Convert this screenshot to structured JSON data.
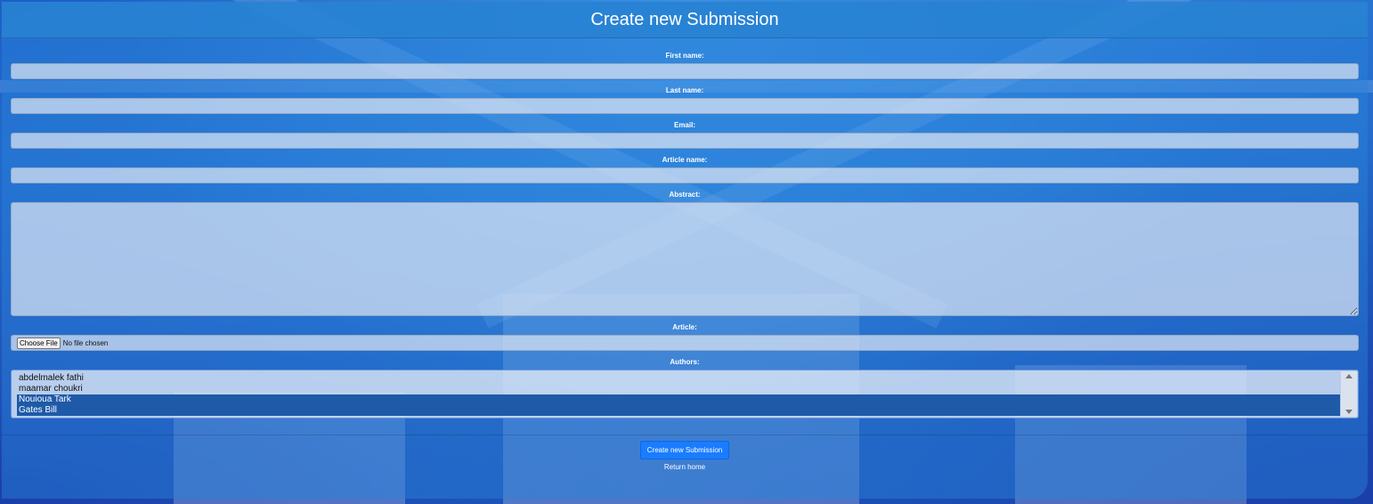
{
  "header": {
    "title": "Create new Submission"
  },
  "form": {
    "first_name_label": "First name:",
    "first_name_value": "",
    "last_name_label": "Last name:",
    "last_name_value": "",
    "email_label": "Email:",
    "email_value": "",
    "article_name_label": "Article name:",
    "article_name_value": "",
    "abstract_label": "Abstract:",
    "abstract_value": "",
    "article_label": "Article:",
    "file_button_label": "Choose File",
    "file_status": "No file chosen",
    "authors_label": "Authors:",
    "authors": [
      {
        "name": "abdelmalek fathi",
        "selected": false
      },
      {
        "name": "maamar choukri",
        "selected": false
      },
      {
        "name": "Nouioua Tark",
        "selected": true
      },
      {
        "name": "Gates Bill",
        "selected": true
      }
    ]
  },
  "actions": {
    "submit_label": "Create new Submission",
    "return_label": "Return home"
  }
}
